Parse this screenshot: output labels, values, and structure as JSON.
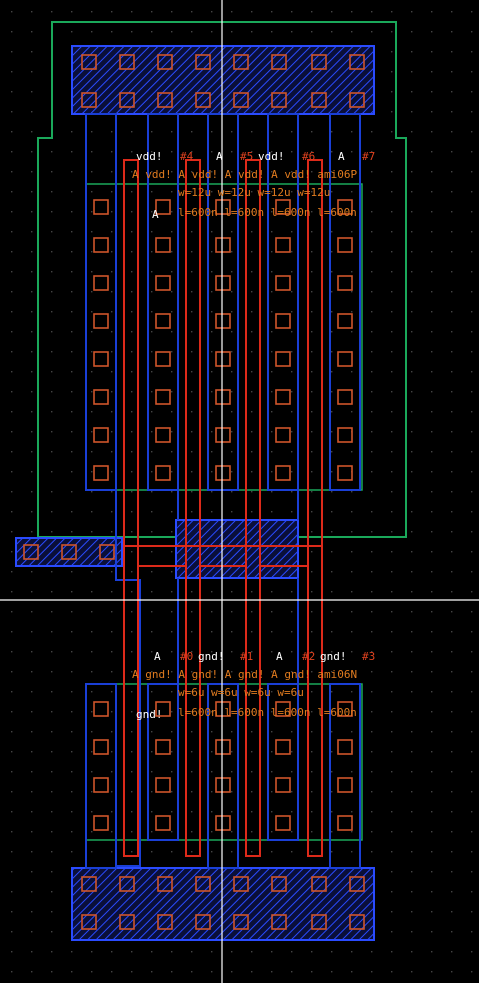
{
  "window": {
    "title": ""
  },
  "colors": {
    "background": "#000000",
    "grid_dot": "#3c3c3c",
    "nwell": "#1aa85a",
    "metal": "#1a3fd6",
    "poly": "#dd2a1a",
    "contact": "#d0552a",
    "label_text": "#ffffff",
    "param_text": "#e07b1f",
    "pin_text": "#e0421f",
    "cross": "#ffffff"
  },
  "pmos": {
    "top_row": [
      {
        "net": "vdd!",
        "pin": "#4"
      },
      {
        "net": "A",
        "pin": "#5"
      },
      {
        "net": "vdd!",
        "pin": "#6"
      },
      {
        "net": "A",
        "pin": "#7"
      }
    ],
    "overlap_text": "A vdd! A vdd! A vdd! A vdd! ami06P",
    "width_text": "w=12u w=12u w=12u w=12u",
    "length_text": "l=600n l=600n l=600n l=600n",
    "gate_text": "A"
  },
  "nmos": {
    "top_row": [
      {
        "net": "A",
        "pin": "#0"
      },
      {
        "net": "gnd!",
        "pin": "#1"
      },
      {
        "net": "A",
        "pin": "#2"
      },
      {
        "net": "gnd!",
        "pin": "#3"
      }
    ],
    "overlap_text": "A gnd! A gnd! A gnd! A gnd! ami06N",
    "width_text": "w=6u w=6u w=6u w=6u",
    "length_text": "l=600n l=600n l=600n l=600n",
    "gate_text": "gnd!"
  }
}
